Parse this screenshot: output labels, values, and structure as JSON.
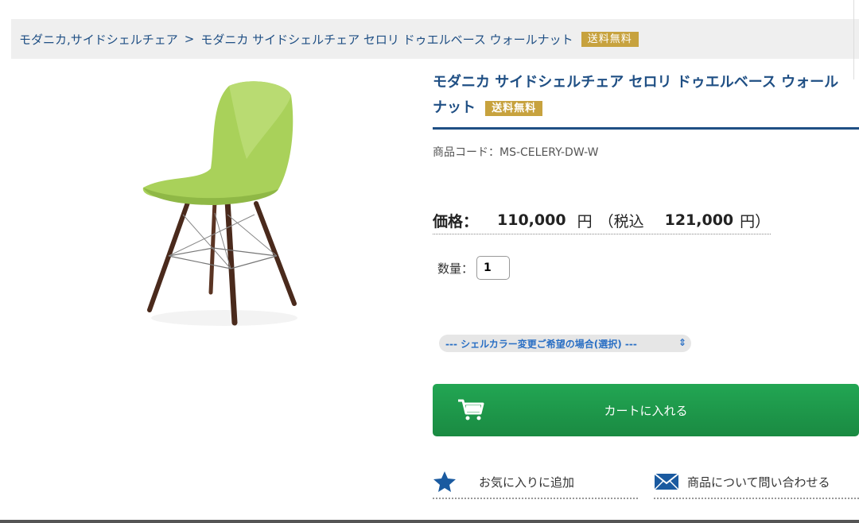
{
  "breadcrumb": {
    "category": "モダニカ,サイドシェルチェア",
    "separator": ">",
    "product": "モダニカ サイドシェルチェア セロリ ドゥエルベース ウォールナット",
    "badge": "送料無料"
  },
  "product": {
    "title_line1": "モダニカ サイドシェルチェア セロリ ドゥエルベース ウォール",
    "title_line2": "ナット",
    "badge": "送料無料",
    "code": "商品コード：MS-CELERY-DW-W"
  },
  "price": {
    "label": "価格：",
    "value": "110,000",
    "unit": "円",
    "tax_label": "（税込",
    "tax_value": "121,000",
    "tax_unit": "円）"
  },
  "quantity": {
    "label": "数量：",
    "value": "1"
  },
  "option_select": {
    "selected": "--- シェルカラー変更ご希望の場合(選択) ---"
  },
  "actions": {
    "add_to_cart": "カートに入れる",
    "favorite": "お気に入りに追加",
    "inquiry": "商品について問い合わせる"
  },
  "colors": {
    "link": "#1f4f84",
    "badge": "#c7a23e",
    "cart_green": "#1f9a4b",
    "shell_green": "#a9d15a",
    "leg_walnut": "#4a2a1c"
  }
}
